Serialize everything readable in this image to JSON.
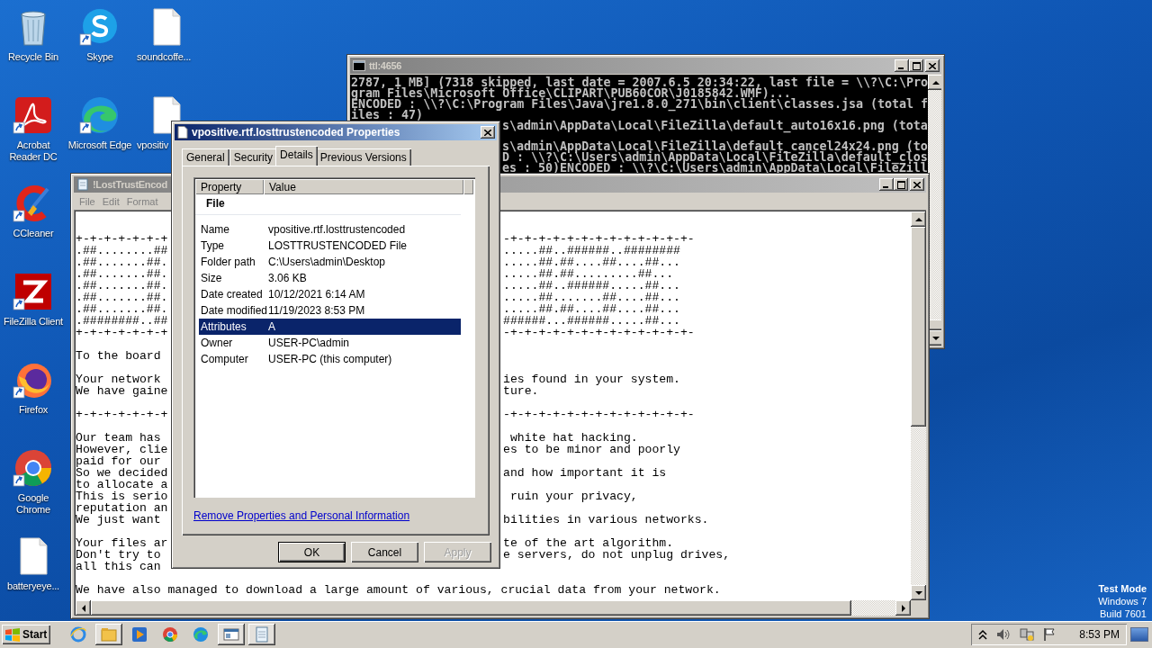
{
  "desktop_columns": [
    [
      {
        "label": "Recycle Bin",
        "kind": "recycle",
        "shortcut": false
      },
      {
        "label": "Acrobat Reader DC",
        "kind": "acrobat",
        "shortcut": true
      },
      {
        "label": "CCleaner",
        "kind": "ccleaner",
        "shortcut": true
      },
      {
        "label": "FileZilla Client",
        "kind": "filezilla",
        "shortcut": true
      },
      {
        "label": "Firefox",
        "kind": "firefox",
        "shortcut": true
      },
      {
        "label": "Google Chrome",
        "kind": "chrome",
        "shortcut": true
      },
      {
        "label": "batteryeye...",
        "kind": "document",
        "shortcut": false
      }
    ],
    [
      {
        "label": "Skype",
        "kind": "skype",
        "shortcut": true
      },
      {
        "label": "Microsoft Edge",
        "kind": "edge",
        "shortcut": true
      }
    ],
    [
      {
        "label": "soundcoffe...",
        "kind": "document",
        "shortcut": false
      },
      {
        "label": "vpositiv",
        "kind": "document",
        "shortcut": false
      }
    ]
  ],
  "desktop_notice": [
    "Test Mode",
    "Windows 7",
    "Build 7601"
  ],
  "console_window": {
    "title": "ttl:4656",
    "paragraphs": [
      [
        {
          "text": "2787, 1 MB] (7318 skipped, last date = 2007.6.5 20:34:22, last file = \\\\?\\C:\\Pro",
          "cut_left": false
        },
        {
          "text": "gram Files\\Microsoft Office\\CLIPART\\PUB60COR\\J0185842.WMF)...",
          "cut_left": false
        },
        {
          "text": "ENCODED : \\\\?\\C:\\Program Files\\Java\\jre1.8.0_271\\bin\\client\\classes.jsa (total f",
          "cut_left": false
        },
        {
          "text": "iles : 47)",
          "cut_left": false
        },
        {
          "text": "s\\admin\\AppData\\Local\\FileZilla\\default_auto16x16.png (tota",
          "cut_left": true
        }
      ],
      [
        {
          "text": "s\\admin\\AppData\\Local\\FileZilla\\default_cancel24x24.png (to",
          "cut_left": true
        },
        {
          "text": "D : \\\\?\\C:\\Users\\admin\\AppData\\Local\\FileZilla\\default_clos",
          "cut_left": true
        },
        {
          "text": "es : 50)ENCODED : \\\\?\\C:\\Users\\admin\\AppData\\Local\\FileZill",
          "cut_left": true
        }
      ]
    ]
  },
  "notepad_window": {
    "title": "!LostTrustEncod",
    "menu": [
      "File",
      "Edit",
      "Format"
    ],
    "paragraphs": [
      [
        {
          "left": "+-+-+-+-+-+-+",
          "right": "-+-+-+-+-+-+-+-+-+-+-+-+-+-"
        },
        {
          "left": ".##........##",
          "right": ".....##..######..########"
        },
        {
          "left": ".##.......##.",
          "right": ".....##.##....##....##..."
        },
        {
          "left": ".##.......##.",
          "right": ".....##.##.........##..."
        },
        {
          "left": ".##.......##.",
          "right": ".....##..######.....##..."
        },
        {
          "left": ".##.......##.",
          "right": ".....##.......##....##..."
        },
        {
          "left": ".##.......##.",
          "right": ".....##.##....##....##..."
        },
        {
          "left": ".########..##",
          "right": "######...######.....##..."
        },
        {
          "left": "+-+-+-+-+-+-+",
          "right": "-+-+-+-+-+-+-+-+-+-+-+-+-+-"
        }
      ],
      [
        {
          "left": "To the board"
        }
      ],
      [
        {
          "left": "Your network",
          "right": "ies found in your system."
        },
        {
          "left": "We have gaine",
          "right": "ture."
        }
      ],
      [
        {
          "left": "+-+-+-+-+-+-+",
          "right": "-+-+-+-+-+-+-+-+-+-+-+-+-+-"
        }
      ],
      [
        {
          "left": "Our team has",
          "right": " white hat hacking."
        },
        {
          "left": "However, clie",
          "right": "es to be minor and poorly"
        },
        {
          "left": "paid for our"
        },
        {
          "left": "So we decided",
          "right": "and how important it is"
        },
        {
          "left": "to allocate a"
        },
        {
          "left": "This is serio",
          "right": " ruin your privacy,"
        },
        {
          "left": "reputation an"
        },
        {
          "left": "We just want",
          "right": "bilities in various networks."
        }
      ],
      [
        {
          "left": "Your files ar",
          "right": "te of the art algorithm."
        },
        {
          "left": "Don't try to",
          "right": "e servers, do not unplug drives,"
        },
        {
          "left": "all this can"
        }
      ],
      [
        {
          "left": "We have also managed to download a large amount of various, crucial data from your network."
        }
      ]
    ]
  },
  "properties_dialog": {
    "title": "vpositive.rtf.losttrustencoded Properties",
    "tabs": [
      {
        "label": "General",
        "selected": false
      },
      {
        "label": "Security",
        "selected": false
      },
      {
        "label": "Details",
        "selected": true
      },
      {
        "label": "Previous Versions",
        "selected": false
      }
    ],
    "columns": [
      "Property",
      "Value"
    ],
    "group": "File",
    "rows": [
      {
        "property": "Name",
        "value": "vpositive.rtf.losttrustencoded",
        "selected": false
      },
      {
        "property": "Type",
        "value": "LOSTTRUSTENCODED File",
        "selected": false
      },
      {
        "property": "Folder path",
        "value": "C:\\Users\\admin\\Desktop",
        "selected": false
      },
      {
        "property": "Size",
        "value": "3.06 KB",
        "selected": false
      },
      {
        "property": "Date created",
        "value": "10/12/2021 6:14 AM",
        "selected": false
      },
      {
        "property": "Date modified",
        "value": "11/19/2023 8:53 PM",
        "selected": false
      },
      {
        "property": "Attributes",
        "value": "A",
        "selected": true
      },
      {
        "property": "Owner",
        "value": "USER-PC\\admin",
        "selected": false
      },
      {
        "property": "Computer",
        "value": "USER-PC (this computer)",
        "selected": false
      }
    ],
    "link": "Remove Properties and Personal Information",
    "buttons": [
      {
        "label": "OK",
        "default": true,
        "disabled": false
      },
      {
        "label": "Cancel",
        "default": false,
        "disabled": false
      },
      {
        "label": "Apply",
        "default": false,
        "disabled": true
      }
    ]
  },
  "taskbar": {
    "start": "Start",
    "apps": [
      {
        "kind": "ie",
        "open": false
      },
      {
        "kind": "explorer",
        "open": true
      },
      {
        "kind": "media",
        "open": false
      },
      {
        "kind": "chrome",
        "open": false
      },
      {
        "kind": "edge",
        "open": false
      },
      {
        "kind": "window",
        "open": true
      },
      {
        "kind": "notepad",
        "open": true
      }
    ],
    "clock": "8:53 PM"
  }
}
